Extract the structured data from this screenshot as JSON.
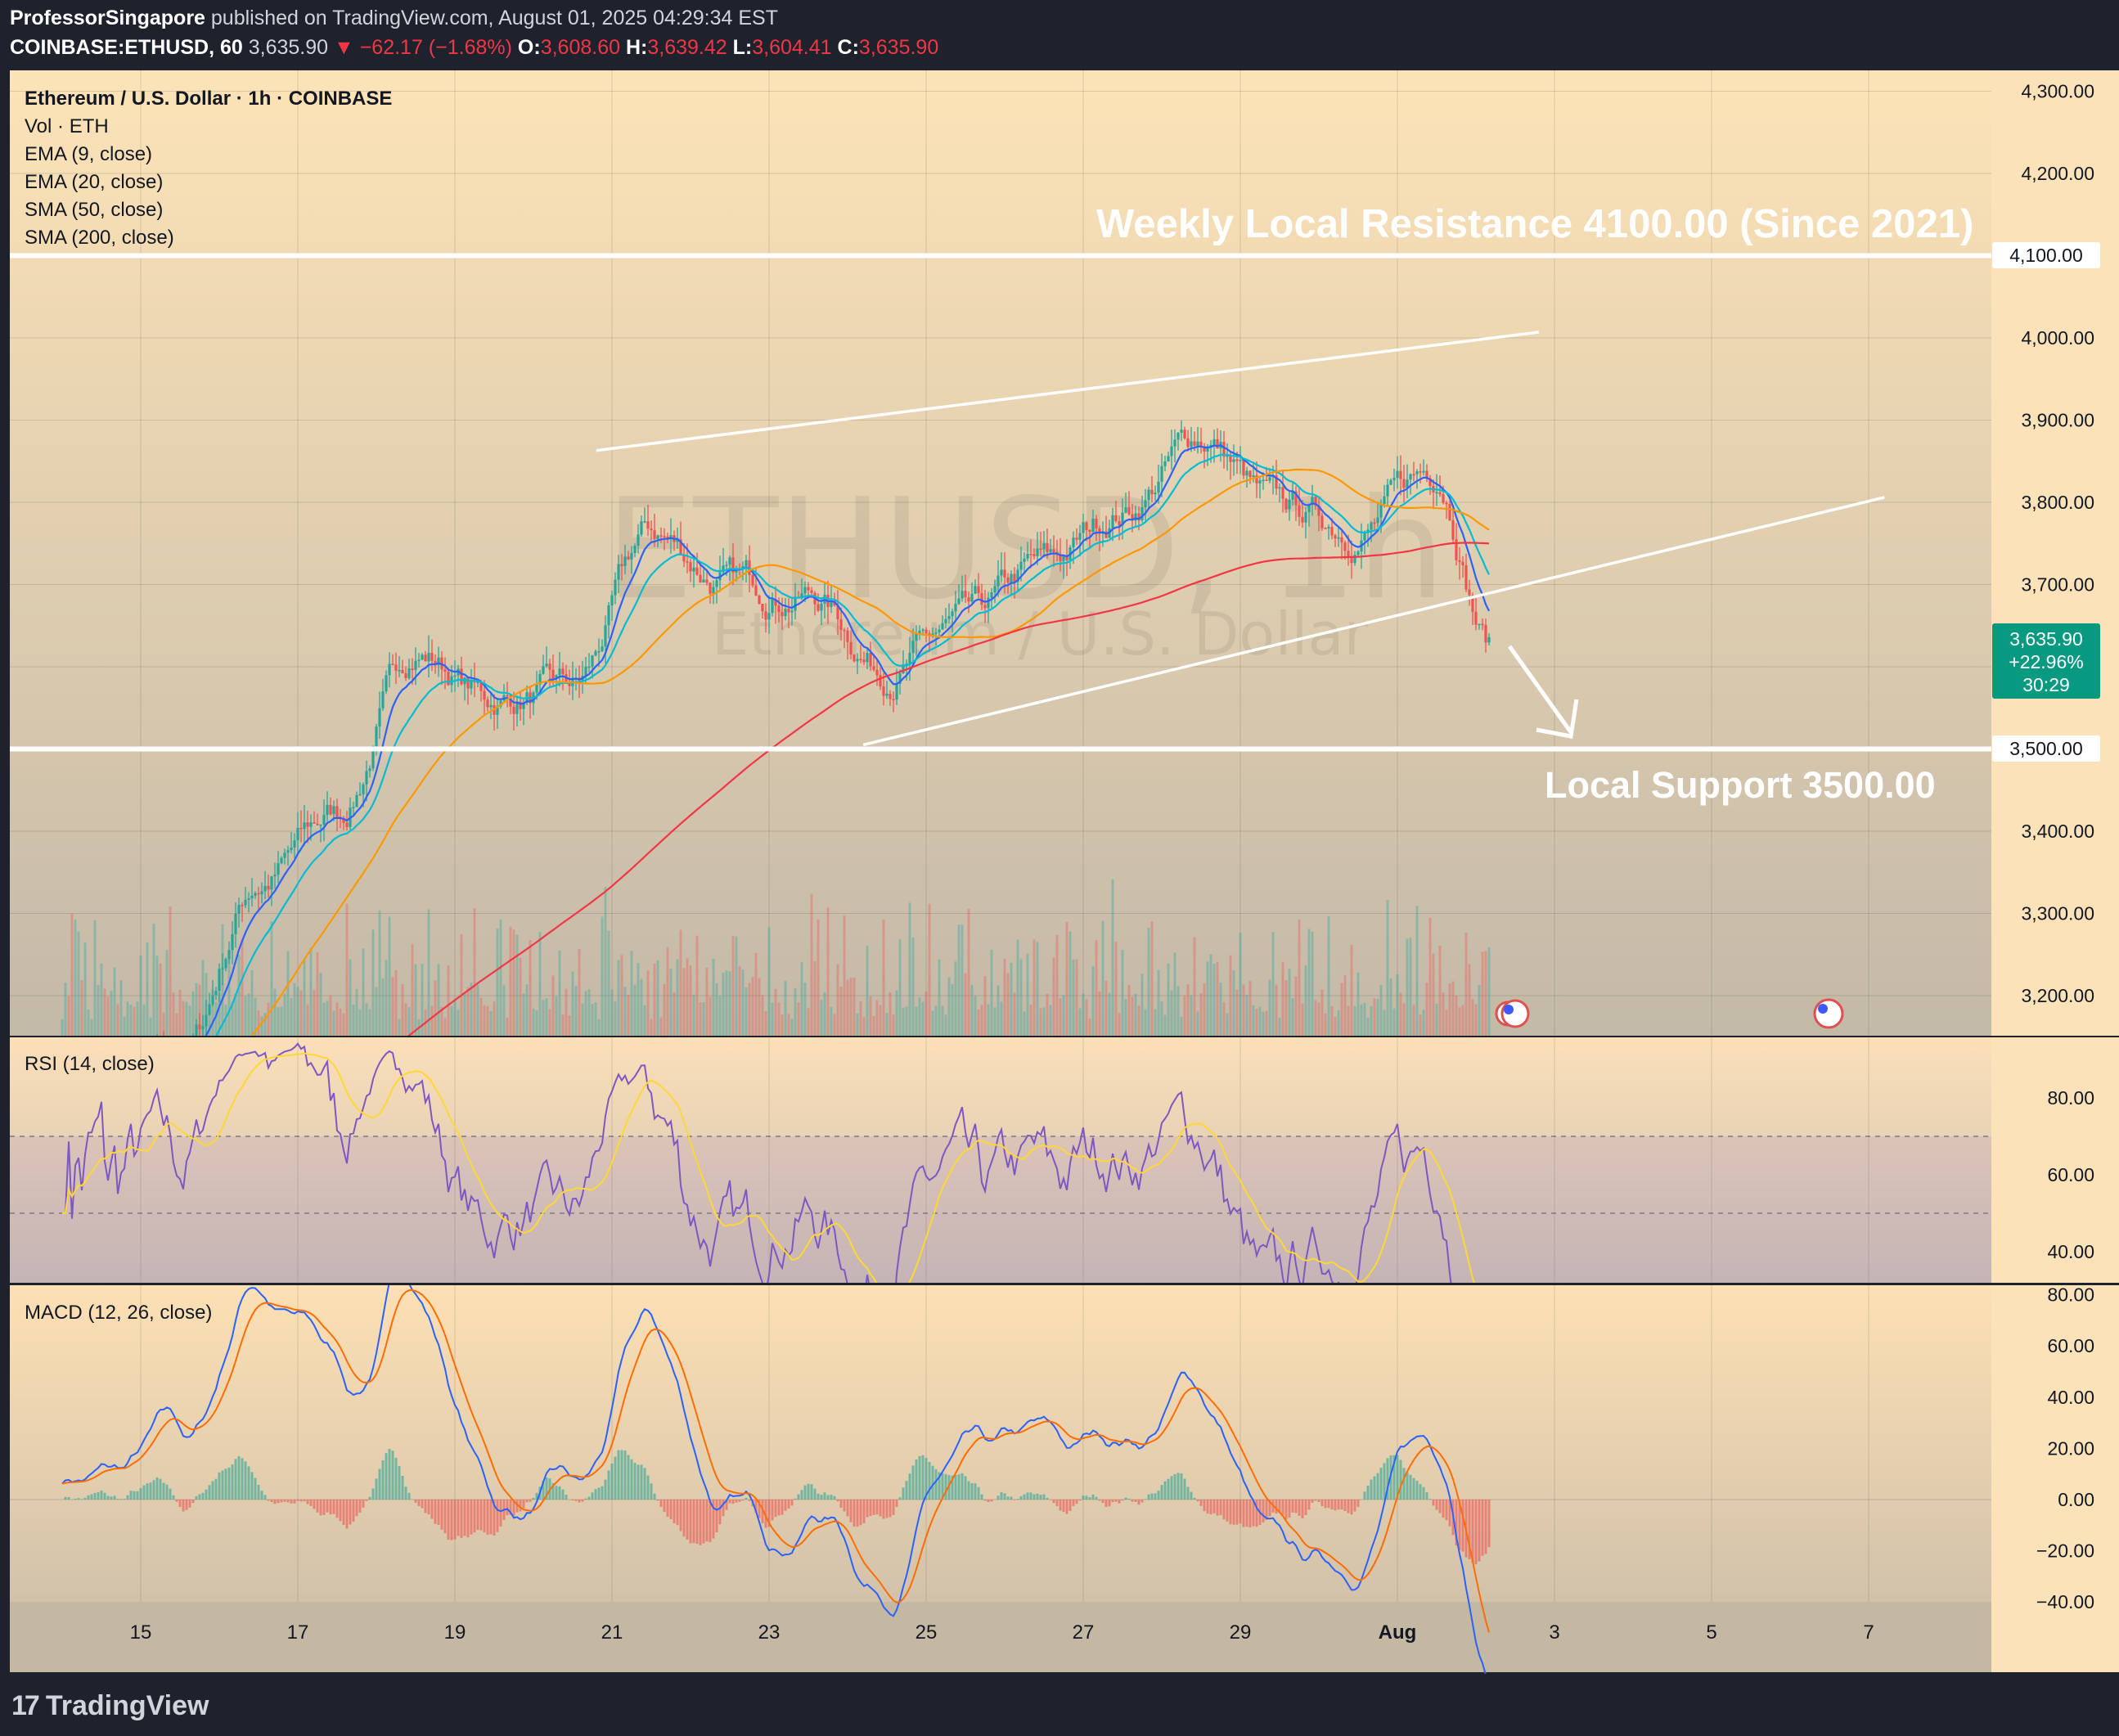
{
  "header": {
    "author": "ProfessorSingapore",
    "published": "published on TradingView.com, August 01, 2025 04:29:34 EST",
    "symbol": "COINBASE:ETHUSD, 60",
    "last": "3,635.90",
    "change": "−62.17 (−1.68%)",
    "o_label": "O:",
    "o": "3,608.60",
    "h_label": "H:",
    "h": "3,639.42",
    "l_label": "L:",
    "l": "3,604.41",
    "c_label": "C:",
    "c": "3,635.90"
  },
  "legend": [
    "Ethereum / U.S. Dollar · 1h · COINBASE",
    "Vol · ETH",
    "EMA (9, close)",
    "EMA (20, close)",
    "SMA (50, close)",
    "SMA (200, close)"
  ],
  "watermark": {
    "symbol": "ETHUSD, 1h",
    "name": "Ethereum / U.S. Dollar"
  },
  "annotations": {
    "resistance": "Weekly Local Resistance 4100.00 (Since 2021)",
    "support": "Local Support 3500.00"
  },
  "price_badge": {
    "price": "3,635.90",
    "pct": "+22.96%",
    "countdown": "30:29"
  },
  "resistance_label": "4,100.00",
  "support_label": "3,500.00",
  "rsi_title": "RSI (14, close)",
  "macd_title": "MACD (12, 26, close)",
  "brand": "TradingView",
  "colors": {
    "up": "#26a69a",
    "down": "#ef5350",
    "ema9": "#2962ff",
    "ema20": "#00bcd4",
    "sma50": "#ff9800",
    "sma200": "#f23645",
    "rsi": "#7e57c2",
    "rsi_ma": "#fdd835",
    "macd": "#2962ff",
    "signal": "#ff6d00",
    "badge": "#089981"
  },
  "chart_data": {
    "type": "candlestick",
    "price_axis": [
      "4,300.00",
      "4,200.00",
      "4,100.00",
      "4,000.00",
      "3,900.00",
      "3,800.00",
      "3,700.00",
      "3,600.00",
      "3,500.00",
      "3,400.00",
      "3,300.00",
      "3,200.00"
    ],
    "price_ylim": [
      3150,
      4320
    ],
    "x_ticks": [
      "15",
      "17",
      "19",
      "21",
      "23",
      "25",
      "27",
      "29",
      "Aug",
      "3",
      "5",
      "7"
    ],
    "ohlc_anchors": [
      {
        "date": "Jul 14",
        "close": 3050
      },
      {
        "date": "Jul 15",
        "close": 3120
      },
      {
        "date": "Jul 16",
        "close": 3340
      },
      {
        "date": "Jul 17",
        "close": 3420
      },
      {
        "date": "Jul 18",
        "close": 3620
      },
      {
        "date": "Jul 19",
        "close": 3560
      },
      {
        "date": "Jul 20",
        "close": 3570
      },
      {
        "date": "Jul 21",
        "close": 3760
      },
      {
        "date": "Jul 22",
        "close": 3700
      },
      {
        "date": "Jul 23",
        "close": 3690
      },
      {
        "date": "Jul 24",
        "close": 3600
      },
      {
        "date": "Jul 25",
        "close": 3650
      },
      {
        "date": "Jul 26",
        "close": 3720
      },
      {
        "date": "Jul 27",
        "close": 3790
      },
      {
        "date": "Jul 28",
        "close": 3880
      },
      {
        "date": "Jul 29",
        "close": 3790
      },
      {
        "date": "Jul 30",
        "close": 3770
      },
      {
        "date": "Jul 31",
        "close": 3840
      },
      {
        "date": "Aug 1",
        "close": 3635.9
      }
    ],
    "levels": [
      {
        "name": "resistance",
        "value": 4100
      },
      {
        "name": "support",
        "value": 3500
      }
    ],
    "channel": {
      "upper": [
        {
          "date": "Jul 20.8",
          "value": 3863
        },
        {
          "date": "Aug 1.8",
          "value": 4007
        }
      ],
      "lower": [
        {
          "date": "Jul 24.2",
          "value": 3505
        },
        {
          "date": "Aug 6.2",
          "value": 3806
        }
      ]
    },
    "rsi": {
      "axis": [
        "80.00",
        "60.00",
        "40.00"
      ],
      "ylim": [
        32,
        88
      ],
      "overbought": 70,
      "oversold": 50
    },
    "macd": {
      "axis": [
        "80.00",
        "60.00",
        "40.00",
        "20.00",
        "0.00",
        "−20.00",
        "−40.00"
      ],
      "ylim": [
        -46,
        82
      ]
    }
  }
}
